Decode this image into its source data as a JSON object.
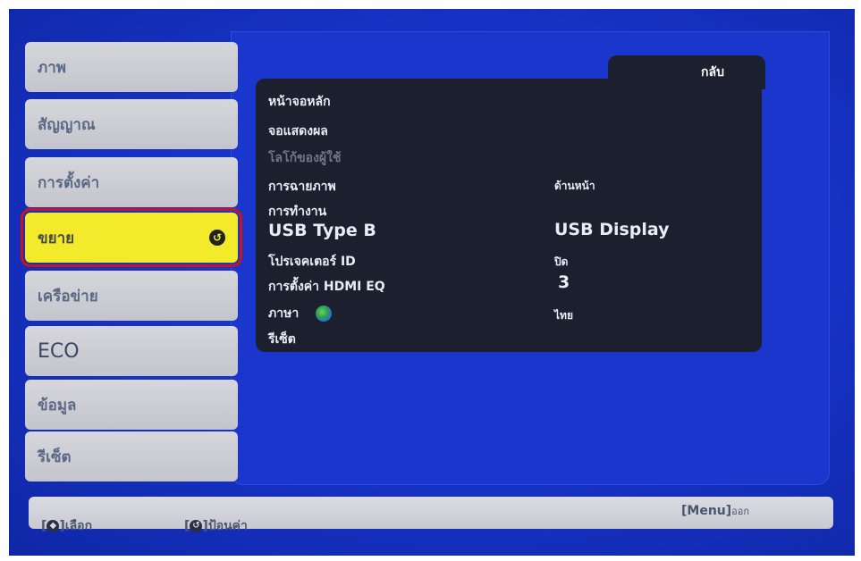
{
  "sidebar": {
    "items": [
      {
        "label": "ภาพ"
      },
      {
        "label": "สัญญาณ"
      },
      {
        "label": "การตั้งค่า"
      },
      {
        "label": "ขยาย"
      },
      {
        "label": "เครือข่าย"
      },
      {
        "label": "ECO"
      },
      {
        "label": "ข้อมูล"
      },
      {
        "label": "รีเซ็ต"
      }
    ],
    "selected_index": 3
  },
  "submenu": {
    "back_label": "กลับ",
    "rows": [
      {
        "label": "หน้าจอหลัก",
        "value": ""
      },
      {
        "label": "จอแสดงผล",
        "value": ""
      },
      {
        "label": "โลโก้ของผู้ใช้",
        "value": ""
      },
      {
        "label": "การฉายภาพ",
        "value": "ด้านหน้า"
      },
      {
        "label": "การทำงาน",
        "value": ""
      },
      {
        "label": "USB Type B",
        "value": "USB Display"
      },
      {
        "label": "โปรเจคเตอร์ ID",
        "value": "ปิด"
      },
      {
        "label": "การตั้งค่า HDMI EQ",
        "value": "3"
      },
      {
        "label": "ภาษา",
        "value": "ไทย"
      },
      {
        "label": "รีเซ็ต",
        "value": ""
      }
    ]
  },
  "footer": {
    "select_key": "◆",
    "select_label": "เลือก",
    "enter_key": "↺",
    "enter_label": "ป้อนค่า",
    "menu_key": "[Menu]",
    "menu_label": "ออก"
  },
  "colors": {
    "screen_blue": "#1632c4",
    "selected_yellow": "#f2ea2a",
    "highlight_red": "#c8151b"
  }
}
